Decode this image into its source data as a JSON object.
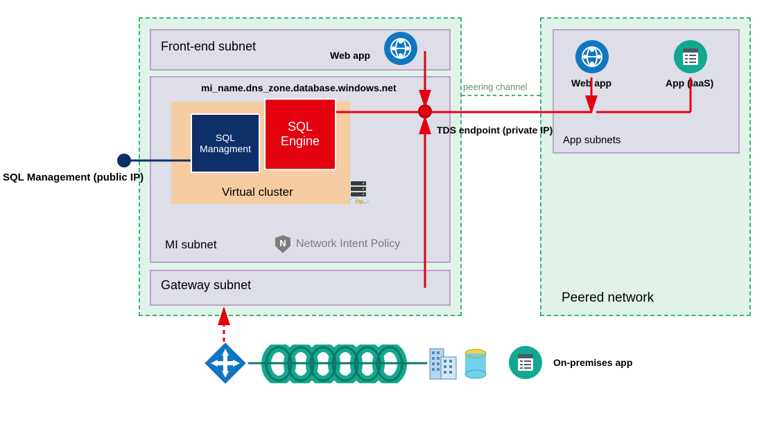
{
  "left_network": {
    "frontend_subnet_label": "Front-end subnet",
    "webapp_label": "Web app",
    "mi_subnet_label": "MI subnet",
    "dns_label": "mi_name.dns_zone.database.windows.net",
    "sql_management_box": "SQL\nManagment",
    "sql_engine_box": "SQL\nEngine",
    "virtual_cluster_label": "Virtual cluster",
    "network_intent_policy_label": "Network Intent Policy",
    "gateway_subnet_label": "Gateway subnet"
  },
  "endpoints": {
    "tds_label": "TDS endpoint (private IP)",
    "sql_mgmt_public_label": "SQL Management (public IP)",
    "peering_channel_label": "peering channel"
  },
  "right_network": {
    "title": "Peered network",
    "webapp_label": "Web app",
    "app_iaas_label": "App (IaaS)",
    "app_subnets_label": "App subnets"
  },
  "bottom": {
    "onprem_label": "On-premises app"
  },
  "colors": {
    "green_border": "#3AB57A",
    "green_fill": "#CBEBDA",
    "purple_border": "#bda0cc",
    "purple_fill": "#DBD0E8",
    "orange_fill": "#f6cda2",
    "navy": "#0d2f6a",
    "red": "#e3000f",
    "azure_blue": "#1077bf",
    "teal": "#12a88f",
    "grey": "#7d7d7d"
  }
}
